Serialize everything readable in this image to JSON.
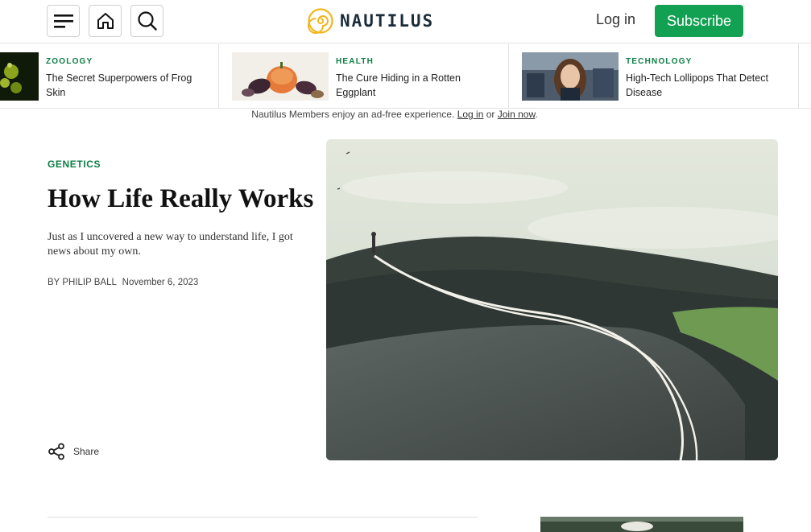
{
  "header": {
    "icons": [
      "menu-icon",
      "home-icon",
      "search-icon"
    ],
    "logo_text": "NAUTILUS",
    "login_label": "Log in",
    "subscribe_label": "Subscribe",
    "brand_green": "#12a152",
    "logo_yellow": "#f3b51a"
  },
  "ticker": [
    {
      "category": "ZOOLOGY",
      "title": "The Secret Superpowers of Frog Skin"
    },
    {
      "category": "HEALTH",
      "title": "The Cure Hiding in a Rotten Eggplant"
    },
    {
      "category": "TECHNOLOGY",
      "title": "High-Tech Lollipops That Detect Disease"
    }
  ],
  "notice": {
    "text": "Nautilus Members enjoy an ad-free experience.",
    "login_link": "Log in",
    "or_text": "or",
    "join_link": "Join now",
    "end": "."
  },
  "article": {
    "category": "GENETICS",
    "title": "How Life Really Works",
    "dek": "Just as I uncovered a new way to understand life, I got news about my own.",
    "byline_prefix": "BY",
    "author": "PHILIP BALL",
    "date": "November 6, 2023",
    "share_label": "Share"
  }
}
